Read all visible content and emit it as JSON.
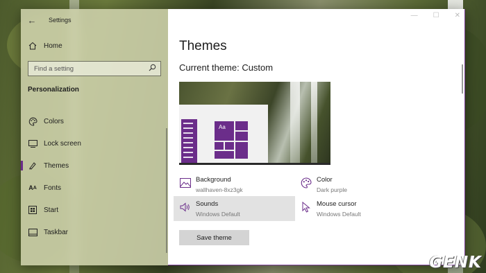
{
  "window": {
    "app_title": "Settings",
    "controls": [
      "—",
      "☐",
      "✕"
    ]
  },
  "sidebar": {
    "home_label": "Home",
    "search_placeholder": "Find a setting",
    "section_title": "Personalization",
    "items": [
      {
        "label": "Colors",
        "icon": "palette-icon"
      },
      {
        "label": "Lock screen",
        "icon": "lock-screen-icon"
      },
      {
        "label": "Themes",
        "icon": "themes-icon",
        "active": true
      },
      {
        "label": "Fonts",
        "icon": "fonts-icon"
      },
      {
        "label": "Start",
        "icon": "start-icon"
      },
      {
        "label": "Taskbar",
        "icon": "taskbar-icon"
      }
    ]
  },
  "content": {
    "page_title": "Themes",
    "current_theme": "Current theme: Custom",
    "preview": {
      "tile_text": "Aa"
    },
    "options": {
      "background": {
        "label": "Background",
        "value": "wallhaven-8xz3gk"
      },
      "color": {
        "label": "Color",
        "value": "Dark purple"
      },
      "sounds": {
        "label": "Sounds",
        "value": "Windows Default"
      },
      "mouse_cursor": {
        "label": "Mouse cursor",
        "value": "Windows Default"
      }
    },
    "save_button": "Save theme"
  },
  "watermark": {
    "logo_text": "GENK"
  },
  "colors": {
    "accent": "#6b2d8a",
    "sidebar_bg": "#ced2ac"
  }
}
